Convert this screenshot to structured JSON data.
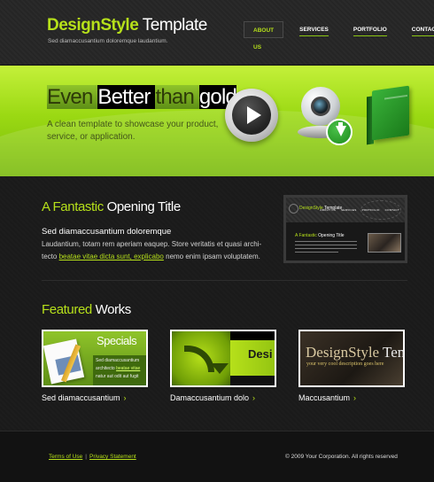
{
  "brand": {
    "logo_part1": "DesignStyle",
    "logo_part2": " Template",
    "tagline": "Sed diamaccusantium doloremque laudantium."
  },
  "nav": {
    "items": [
      "ABOUT US",
      "SERVICES",
      "PORTFOLIO",
      "CONTACT"
    ],
    "active": "ABOUT US"
  },
  "hero": {
    "title_w1": "Even ",
    "title_w2": "Better ",
    "title_w3": "than ",
    "title_w4": "gold",
    "subtitle": "A clean template to showcase your product, service, or application.",
    "icons": [
      "play-icon",
      "webcam-download-icon",
      "green-book-icon"
    ]
  },
  "intro": {
    "title_green": "A Fantastic ",
    "title_white": "Opening Title",
    "heading": "Sed diamaccusantium doloremque",
    "body_1": "Laudantium, totam rem aperiam eaquep. Store veritatis et quasi archi-",
    "body_2a": "tecto ",
    "body_link": "beatae vitae dicta sunt, explicabo",
    "body_2b": " nemo enim ipsam voluptatem."
  },
  "preview_thumb": {
    "logo_a": "DesignStyle",
    "logo_b": " Template",
    "nav": [
      "ABOUT US",
      "SERVICES",
      "PORTFOLIO",
      "CONTACT"
    ],
    "title_g": "A Fantastic ",
    "title_w": "Opening Title"
  },
  "featured": {
    "title_green": "Featured ",
    "title_white": "Works",
    "items": [
      {
        "caption": "Sed diamaccusantium",
        "thumb_title": "Specials",
        "thumb_line1": "Sed diamaccusantium",
        "thumb_line2a": "architecto ",
        "thumb_line2b": "beatae vitae",
        "thumb_line3": "natur aut odit aut fugit"
      },
      {
        "caption": "Damaccusantium dolo",
        "thumb_title": "Desi"
      },
      {
        "caption": "Maccusantium",
        "thumb_title_a": "DesignStyle",
        "thumb_title_b": " Ten",
        "thumb_sub": "your very cool description goes here"
      }
    ],
    "arrow": "›"
  },
  "footer": {
    "link1": "Terms of Use",
    "sep": "|",
    "link2": "Privacy Statement",
    "copyright": "© 2009 Your Corporation. All rights reserved"
  },
  "colors": {
    "accent": "#b6e01a",
    "hero_green": "#9bd913",
    "bg_dark": "#1a1a1a"
  }
}
